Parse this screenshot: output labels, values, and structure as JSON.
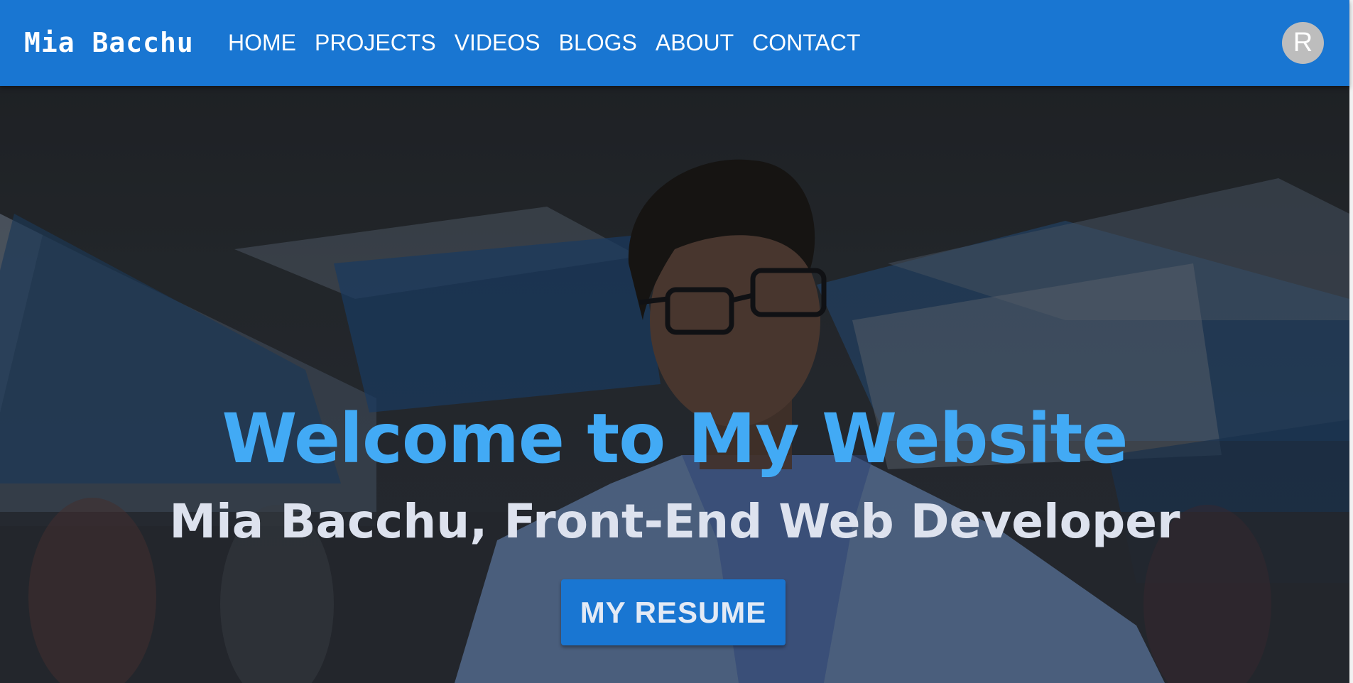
{
  "navbar": {
    "brand": "Mia Bacchu",
    "links": [
      {
        "label": "HOME"
      },
      {
        "label": "PROJECTS"
      },
      {
        "label": "VIDEOS"
      },
      {
        "label": "BLOGS"
      },
      {
        "label": "ABOUT"
      },
      {
        "label": "CONTACT"
      }
    ],
    "avatar_letter": "R"
  },
  "hero": {
    "headline": "Welcome to My Website",
    "subheadline": "Mia Bacchu, Front-End Web Developer",
    "resume_button": "MY RESUME"
  },
  "colors": {
    "primary": "#1976d2",
    "headline": "#42aaf5",
    "subheadline": "#dde2ee",
    "avatar_bg": "#bdbdbd"
  }
}
